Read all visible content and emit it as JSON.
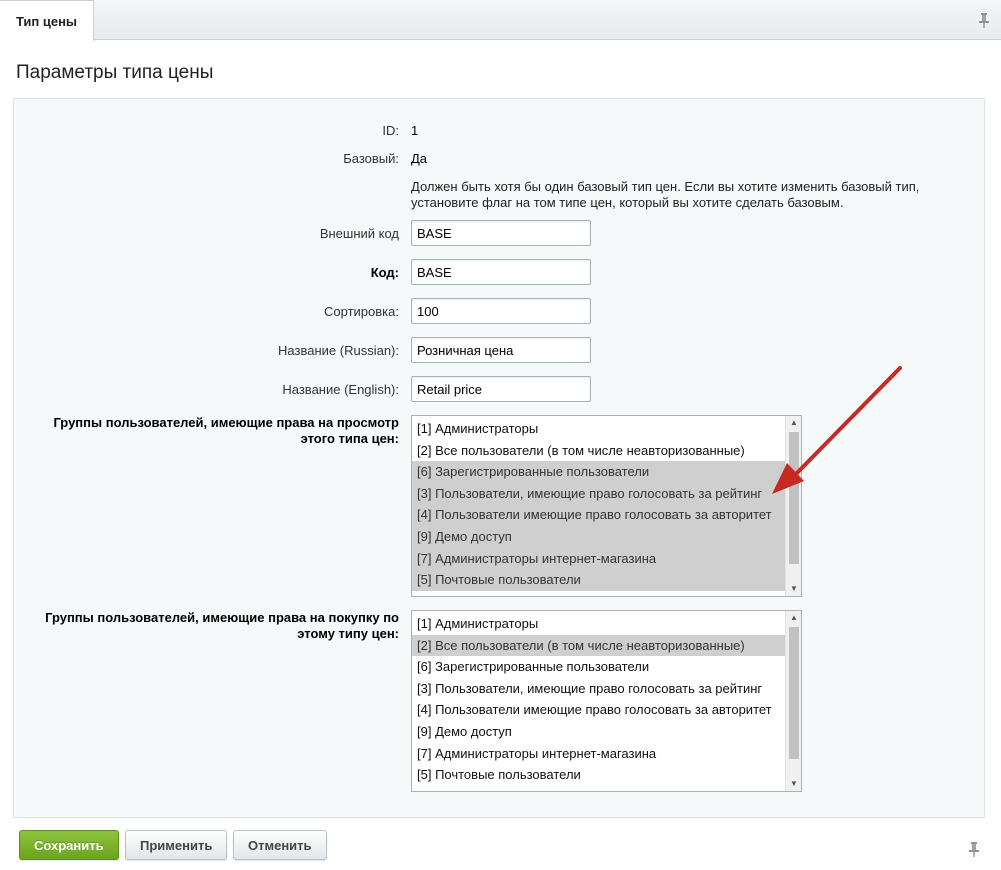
{
  "tabs": [
    {
      "label": "Тип цены"
    }
  ],
  "section": {
    "title": "Параметры типа цены"
  },
  "fields": {
    "id": {
      "label": "ID:",
      "value": "1"
    },
    "base": {
      "label": "Базовый:",
      "value": "Да"
    },
    "base_note": "Должен быть хотя бы один базовый тип цен. Если вы хотите изменить базовый тип, установите флаг на том типе цен, который вы хотите сделать базовым.",
    "external_code": {
      "label": "Внешний код",
      "value": "BASE"
    },
    "code": {
      "label": "Код:",
      "value": "BASE"
    },
    "sort": {
      "label": "Сортировка:",
      "value": "100"
    },
    "name_ru": {
      "label": "Название (Russian):",
      "value": "Розничная цена"
    },
    "name_en": {
      "label": "Название (English):",
      "value": "Retail price"
    }
  },
  "view_groups": {
    "label": "Группы пользователей, имеющие права на просмотр этого типа цен:",
    "options": [
      {
        "text": "[1] Администраторы",
        "selected": false
      },
      {
        "text": "[2] Все пользователи (в том числе неавторизованные)",
        "selected": false
      },
      {
        "text": "[6] Зарегистрированные пользователи",
        "selected": true
      },
      {
        "text": "[3] Пользователи, имеющие право голосовать за рейтинг",
        "selected": true
      },
      {
        "text": "[4] Пользователи имеющие право голосовать за авторитет",
        "selected": true
      },
      {
        "text": "[9] Демо доступ",
        "selected": true
      },
      {
        "text": "[7] Администраторы интернет-магазина",
        "selected": true
      },
      {
        "text": "[5] Почтовые пользователи",
        "selected": true
      }
    ]
  },
  "buy_groups": {
    "label": "Группы пользователей, имеющие права на покупку по этому типу цен:",
    "options": [
      {
        "text": "[1] Администраторы",
        "selected": false
      },
      {
        "text": "[2] Все пользователи (в том числе неавторизованные)",
        "selected": true
      },
      {
        "text": "[6] Зарегистрированные пользователи",
        "selected": false
      },
      {
        "text": "[3] Пользователи, имеющие право голосовать за рейтинг",
        "selected": false
      },
      {
        "text": "[4] Пользователи имеющие право голосовать за авторитет",
        "selected": false
      },
      {
        "text": "[9] Демо доступ",
        "selected": false
      },
      {
        "text": "[7] Администраторы интернет-магазина",
        "selected": false
      },
      {
        "text": "[5] Почтовые пользователи",
        "selected": false
      }
    ]
  },
  "buttons": {
    "save": "Сохранить",
    "apply": "Применить",
    "cancel": "Отменить"
  },
  "colors": {
    "primary": "#6aa41d",
    "selection": "#cfcfcf",
    "annotation_arrow": "#c62a22"
  },
  "icons": {
    "pin": "pin-icon",
    "annotation": "arrow-annotation-icon"
  }
}
